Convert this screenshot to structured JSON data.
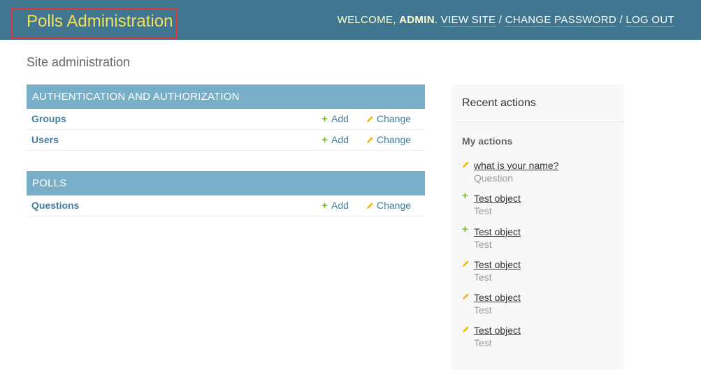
{
  "header": {
    "branding": "Polls Administration",
    "welcome_prefix": "Welcome, ",
    "username": "admin",
    "view_site": "View site",
    "change_password": "Change password",
    "log_out": "Log out"
  },
  "page_title": "Site administration",
  "apps": [
    {
      "name": "Authentication and Authorization",
      "models": [
        {
          "name": "Groups",
          "add": "Add",
          "change": "Change"
        },
        {
          "name": "Users",
          "add": "Add",
          "change": "Change"
        }
      ]
    },
    {
      "name": "Polls",
      "models": [
        {
          "name": "Questions",
          "add": "Add",
          "change": "Change"
        }
      ]
    }
  ],
  "recent_actions": {
    "title": "Recent actions",
    "subtitle": "My actions",
    "items": [
      {
        "type": "change",
        "object": "what is your name?",
        "content_type": "Question"
      },
      {
        "type": "addition",
        "object": "Test object",
        "content_type": "Test"
      },
      {
        "type": "addition",
        "object": "Test object",
        "content_type": "Test"
      },
      {
        "type": "change",
        "object": "Test object",
        "content_type": "Test"
      },
      {
        "type": "change",
        "object": "Test object",
        "content_type": "Test"
      },
      {
        "type": "change",
        "object": "Test object",
        "content_type": "Test"
      }
    ]
  },
  "colors": {
    "header_bg": "#417690",
    "branding": "#f5dd5d",
    "caption_bg": "#79aec8",
    "link": "#447e9b",
    "add_icon": "#70bf2b",
    "change_icon": "#efb80b"
  }
}
